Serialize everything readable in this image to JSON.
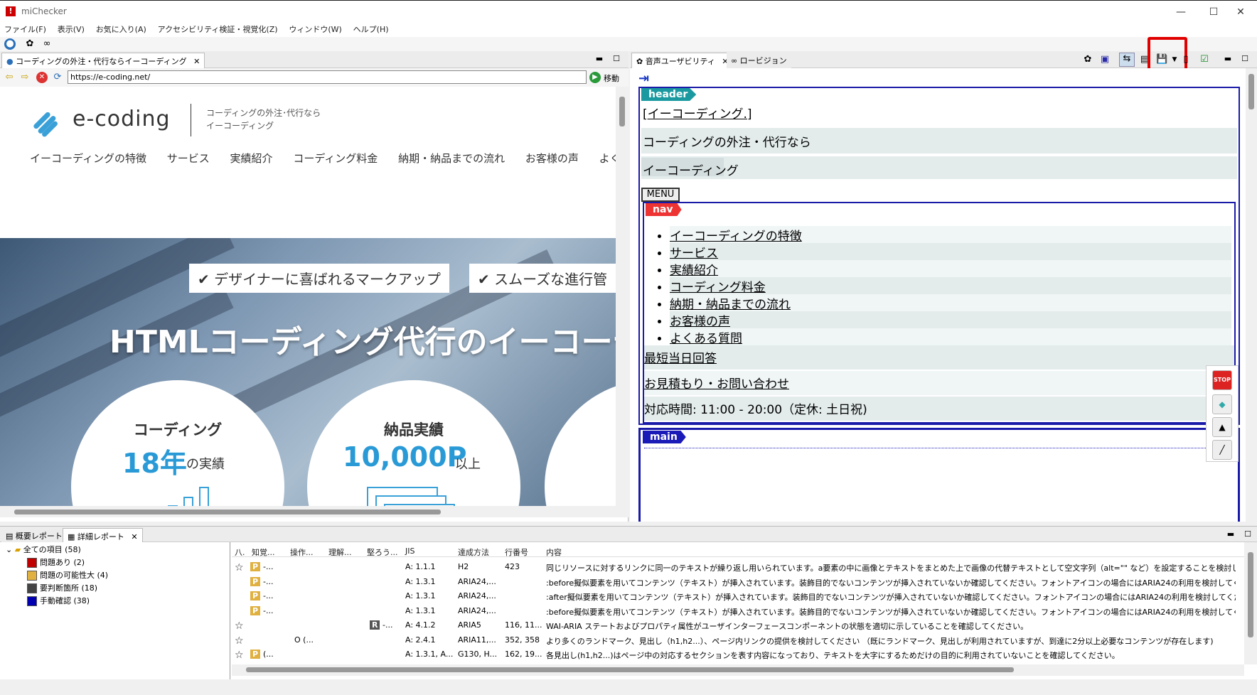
{
  "window": {
    "title": "miChecker",
    "min": "—",
    "max": "☐",
    "close": "✕"
  },
  "menu": [
    "ファイル(F)",
    "表示(V)",
    "お気に入り(A)",
    "アクセシビリティ検証・視覚化(Z)",
    "ウィンドウ(W)",
    "ヘルプ(H)"
  ],
  "left": {
    "tab_label": "コーディングの外注・代行ならイーコーディング",
    "url": "https://e-coding.net/",
    "go_label": "移動",
    "site": {
      "logo": "e-coding",
      "tagline1": "コーディングの外注･代行なら",
      "tagline2": "イーコーディング",
      "nav": [
        "イーコーディングの特徴",
        "サービス",
        "実績紹介",
        "コーディング料金",
        "納期・納品までの流れ",
        "お客様の声",
        "よく"
      ],
      "badge1": "✔ デザイナーに喜ばれるマークアップ",
      "badge2": "✔ スムーズな進行管",
      "headline": "HTMLコーディング代行のイーコーデ",
      "circle1_title": "コーディング",
      "circle1_num": "18年",
      "circle1_suffix": "の実績",
      "circle2_title": "納品実績",
      "circle2_num": "10,000P",
      "circle2_suffix": "以上"
    }
  },
  "right": {
    "tab1": "音声ユーザビリティ",
    "tab2": "ロービジョン",
    "header_label": "header",
    "header_link": "[イーコーディング.]",
    "line1": "コーディングの外注・代行なら",
    "line2": "イーコーディング",
    "menu_btn": "MENU",
    "nav_label": "nav",
    "nav_items": [
      "イーコーディングの特徴",
      "サービス",
      "実績紹介",
      "コーディング料金",
      "納期・納品までの流れ",
      "お客様の声",
      "よくある質問"
    ],
    "link1": "最短当日回答",
    "link2": "お見積もり・お問い合わせ",
    "hours": "対応時間: 11:00 - 20:00（定休: 土日祝)",
    "main_label": "main",
    "stop_label": "STOP"
  },
  "bottom": {
    "tab1": "概要レポート",
    "tab2": "詳細レポート",
    "tree": [
      {
        "label": "全ての項目 (58)",
        "color": ""
      },
      {
        "label": "問題あり (2)",
        "color": "#c00000"
      },
      {
        "label": "問題の可能性大 (4)",
        "color": "#e0b040"
      },
      {
        "label": "要判断箇所 (18)",
        "color": "#444444"
      },
      {
        "label": "手動確認 (38)",
        "color": "#0000b0"
      }
    ],
    "headers": [
      "八.",
      "知覚...",
      "操作...",
      "理解...",
      "堅ろう...",
      "JIS",
      "達成方法",
      "行番号",
      "内容"
    ],
    "rows": [
      {
        "star": "☆",
        "p": "P",
        "pv": "-...",
        "op": "",
        "rb": "",
        "rv": "",
        "jis": "A: 1.1.1",
        "tech": "H2",
        "line": "423",
        "content": "同じリソースに対するリンクに同一のテキストが繰り返し用いられています。a要素の中に画像とテキストをまとめた上で画像の代替テキストとして空文字列（alt=\"\" など）を設定することを検討してください：\"お..."
      },
      {
        "star": "",
        "p": "P",
        "pv": "-...",
        "op": "",
        "rb": "",
        "rv": "",
        "jis": "A: 1.3.1",
        "tech": "ARIA24,...",
        "line": "",
        "content": ":before擬似要素を用いてコンテンツ（テキスト）が挿入されています。装飾目的でないコンテンツが挿入されていないか確認してください。フォントアイコンの場合にはARIA24の利用を検討してください。(https://..."
      },
      {
        "star": "",
        "p": "P",
        "pv": "-...",
        "op": "",
        "rb": "",
        "rv": "",
        "jis": "A: 1.3.1",
        "tech": "ARIA24,...",
        "line": "",
        "content": ":after擬似要素を用いてコンテンツ（テキスト）が挿入されています。装飾目的でないコンテンツが挿入されていないか確認してください。フォントアイコンの場合にはARIA24の利用を検討してください。(https://e-..."
      },
      {
        "star": "",
        "p": "P",
        "pv": "-...",
        "op": "",
        "rb": "",
        "rv": "",
        "jis": "A: 1.3.1",
        "tech": "ARIA24,...",
        "line": "",
        "content": ":before擬似要素を用いてコンテンツ（テキスト）が挿入されています。装飾目的でないコンテンツが挿入されていないか確認してください。フォントアイコンの場合にはARIA24の利用を検討してください。(https://..."
      },
      {
        "star": "☆",
        "p": "",
        "pv": "",
        "op": "",
        "rb": "R",
        "rv": "-...",
        "jis": "A: 4.1.2",
        "tech": "ARIA5",
        "line": "116, 11...",
        "content": "WAI-ARIA ステートおよびプロパティ属性がユーザインターフェースコンポーネントの状態を適切に示していることを確認してください。"
      },
      {
        "star": "☆",
        "p": "",
        "pv": "",
        "op": "O (...",
        "rb": "",
        "rv": "",
        "jis": "A: 2.4.1",
        "tech": "ARIA11,...",
        "line": "352, 358",
        "content": "より多くのランドマーク、見出し（h1,h2...）、ページ内リンクの提供を検討してください （既にランドマーク、見出しが利用されていますが、到達に2分以上必要なコンテンツが存在します)"
      },
      {
        "star": "☆",
        "p": "P",
        "pv": "(...",
        "op": "",
        "rb": "",
        "rv": "",
        "jis": "A: 1.3.1, A...",
        "tech": "G130, H...",
        "line": "162, 19...",
        "content": "各見出し(h1,h2...)はページ中の対応するセクションを表す内容になっており、テキストを大字にするためだけの目的に利用されていないことを確認してください。"
      }
    ]
  }
}
